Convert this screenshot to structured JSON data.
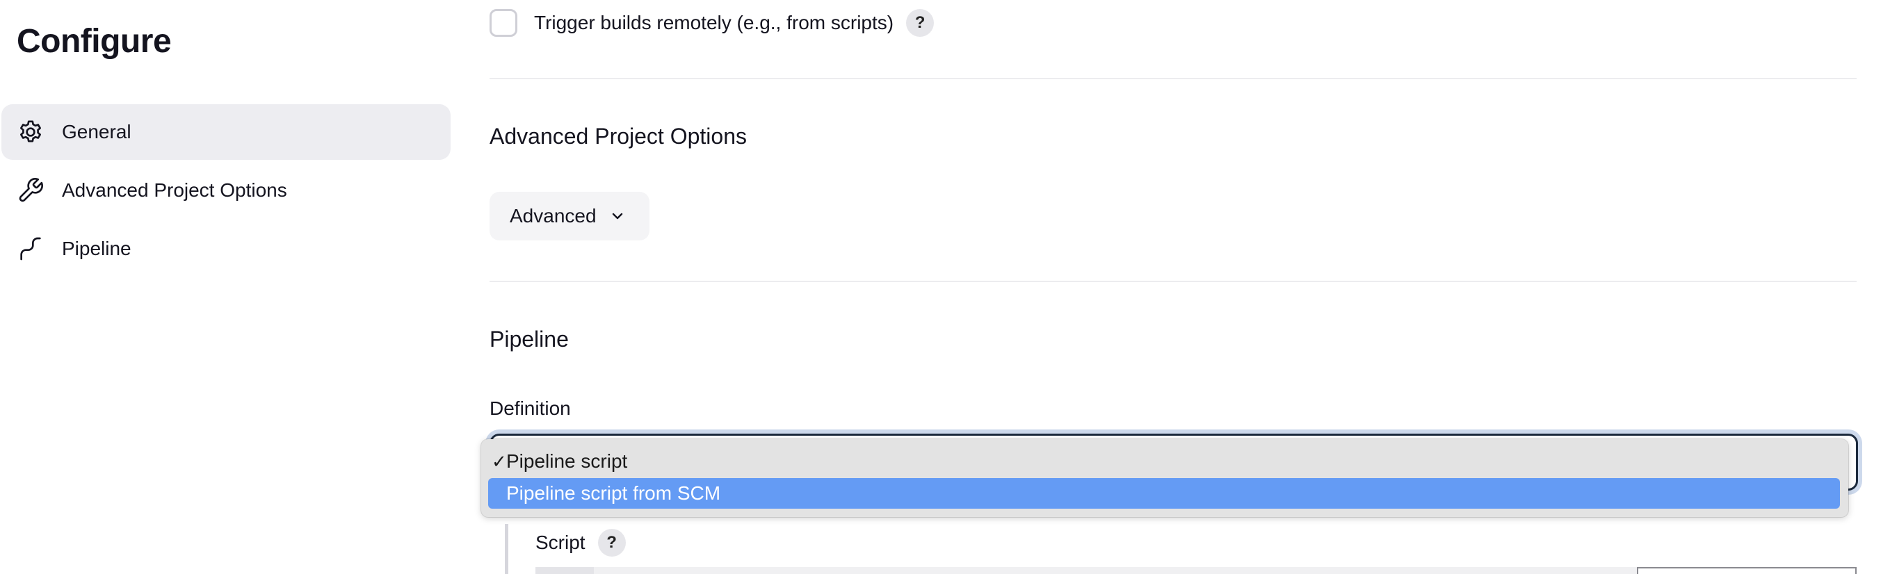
{
  "page": {
    "title": "Configure"
  },
  "sidebar": {
    "items": [
      {
        "label": "General",
        "icon": "gear-icon",
        "active": true
      },
      {
        "label": "Advanced Project Options",
        "icon": "wrench-icon",
        "active": false
      },
      {
        "label": "Pipeline",
        "icon": "pipeline-icon",
        "active": false
      }
    ]
  },
  "triggers": {
    "remote_label": "Trigger builds remotely (e.g., from scripts)",
    "remote_checked": false,
    "help": "?"
  },
  "advanced_section": {
    "title": "Advanced Project Options",
    "button_label": "Advanced"
  },
  "pipeline_section": {
    "title": "Pipeline",
    "definition_label": "Definition",
    "definition_options": [
      {
        "label": "Pipeline script",
        "checked": true,
        "highlighted": false
      },
      {
        "label": "Pipeline script from SCM",
        "checked": false,
        "highlighted": true
      }
    ],
    "check_mark": "✓",
    "script_label": "Script",
    "script_help": "?"
  },
  "colors": {
    "active_nav_bg": "#ededf1",
    "highlight": "#649bf4",
    "focus_ring": "#cdd9ec",
    "text": "#14141f"
  }
}
